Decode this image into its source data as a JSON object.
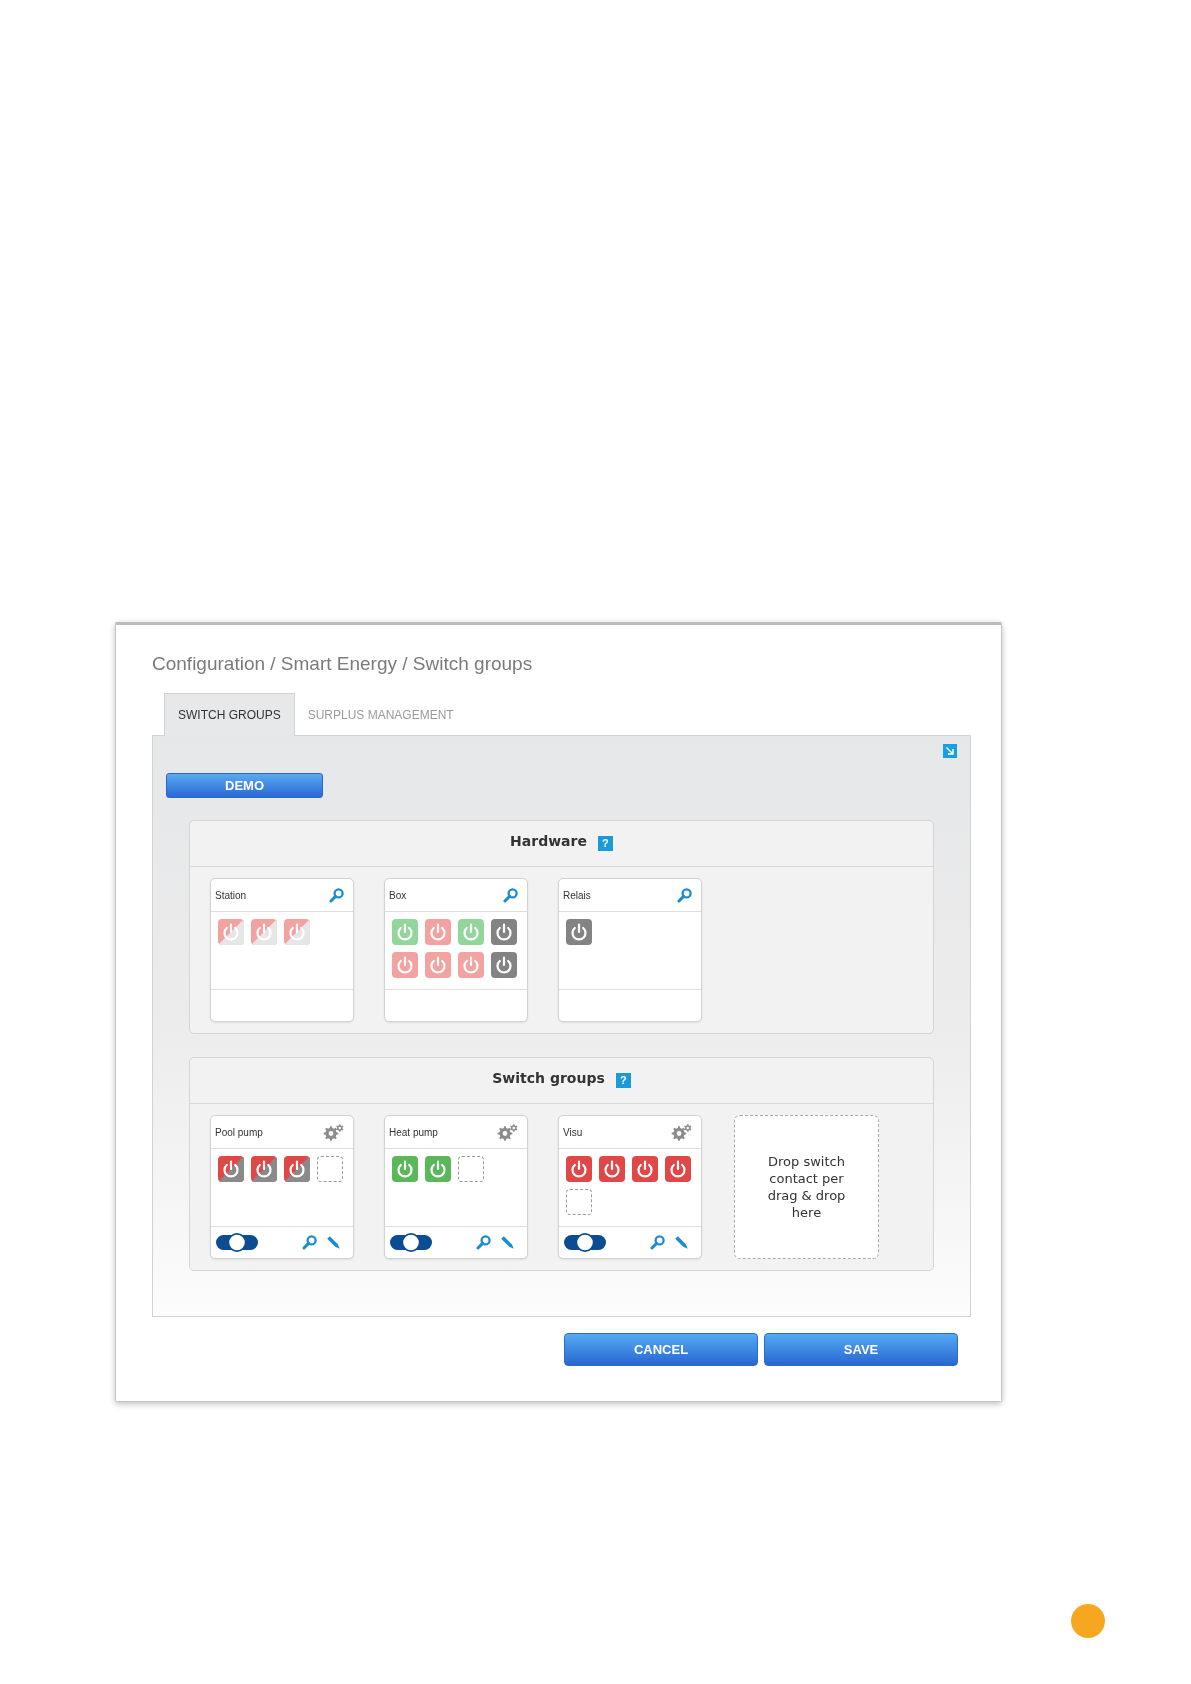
{
  "title": "Configuration / Smart Energy / Switch groups",
  "tabs": [
    {
      "label": "SWITCH GROUPS",
      "selected": true
    },
    {
      "label": "SURPLUS MANAGEMENT",
      "selected": false
    }
  ],
  "demo_button": "DEMO",
  "sections": [
    {
      "title": "Hardware",
      "help": "?",
      "cards": [
        {
          "kind": "device",
          "title": "Station",
          "contacts": [
            {
              "kind": "mixed",
              "dimmed": true
            },
            {
              "kind": "mixed",
              "dimmed": true
            },
            {
              "kind": "mixed",
              "dimmed": true
            }
          ]
        },
        {
          "kind": "device",
          "title": "Box",
          "contacts": [
            {
              "kind": "on",
              "dimmed": true
            },
            {
              "kind": "off",
              "dimmed": true
            },
            {
              "kind": "on",
              "dimmed": true
            },
            {
              "kind": "idle",
              "dimmed": false
            },
            {
              "kind": "off",
              "dimmed": true
            },
            {
              "kind": "off",
              "dimmed": true
            },
            {
              "kind": "off",
              "dimmed": true
            },
            {
              "kind": "idle",
              "dimmed": false
            }
          ]
        },
        {
          "kind": "device",
          "title": "Relais",
          "contacts": [
            {
              "kind": "idle",
              "dimmed": false
            }
          ]
        }
      ]
    },
    {
      "title": "Switch groups",
      "help": "?",
      "cards": [
        {
          "kind": "group",
          "title": "Pool pump",
          "switch": {
            "level": 0.5
          },
          "contacts": [
            {
              "kind": "mixed",
              "dimmed": false
            },
            {
              "kind": "mixed",
              "dimmed": false
            },
            {
              "kind": "mixed",
              "dimmed": false
            },
            {
              "kind": "slot"
            }
          ]
        },
        {
          "kind": "group",
          "title": "Heat pump",
          "switch": {
            "level": 0.5
          },
          "contacts": [
            {
              "kind": "on",
              "dimmed": false
            },
            {
              "kind": "on",
              "dimmed": false
            },
            {
              "kind": "slot"
            }
          ]
        },
        {
          "kind": "group",
          "title": "Visu",
          "switch": {
            "level": 0.5
          },
          "contacts": [
            {
              "kind": "off",
              "dimmed": false
            },
            {
              "kind": "off",
              "dimmed": false
            },
            {
              "kind": "off",
              "dimmed": false
            },
            {
              "kind": "off",
              "dimmed": false
            },
            {
              "kind": "slot"
            }
          ]
        },
        {
          "kind": "dropzone",
          "text": "Drop switch contact per drag & drop here"
        }
      ]
    }
  ],
  "buttons": [
    "CANCEL",
    "SAVE"
  ]
}
